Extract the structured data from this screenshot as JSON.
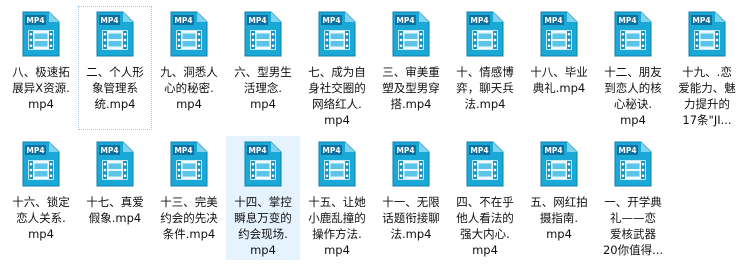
{
  "icon": {
    "name": "mp4-video-file-icon",
    "badge": "MP4",
    "color_main": "#1aa8d6",
    "color_dark": "#0c7fae",
    "color_badge": "#0f6fa0"
  },
  "rows": [
    [
      {
        "label": "八、极速拓\n展异X资源.\nmp4"
      },
      {
        "label": "二、个人形\n象管理系\n统.mp4",
        "focused": true
      },
      {
        "label": "九、洞悉人\n心的秘密.\nmp4"
      },
      {
        "label": "六、型男生\n活理念.\nmp4"
      },
      {
        "label": "七、成为自\n身社交圈的\n网络红人.\nmp4"
      },
      {
        "label": "三、审美重\n塑及型男穿\n搭.mp4"
      },
      {
        "label": "十、情感博\n弈，聊天兵\n法.mp4"
      },
      {
        "label": "十八、毕业\n典礼.mp4"
      },
      {
        "label": "十二、朋友\n到恋人的核\n心秘诀.\nmp4"
      },
      {
        "label": "十九、.恋\n爱能力、魅\n力提升的\n17条\"JI..."
      }
    ],
    [
      {
        "label": "十六、锁定\n恋人关系.\nmp4"
      },
      {
        "label": "十七、真爱\n假象.mp4"
      },
      {
        "label": "十三、完美\n约会的先决\n条件.mp4"
      },
      {
        "label": "十四、掌控\n瞬息万变的\n约会现场.\nmp4",
        "selected": true
      },
      {
        "label": "十五、让她\n小鹿乱撞的\n操作方法.\nmp4"
      },
      {
        "label": "十一、无限\n话题衔接聊\n法.mp4"
      },
      {
        "label": "四、不在乎\n他人看法的\n强大内心.\nmp4"
      },
      {
        "label": "五、网红拍\n摄指南.\nmp4"
      },
      {
        "label": "一、开学典\n礼——恋\n爱核武器\n20你值得..."
      }
    ]
  ]
}
